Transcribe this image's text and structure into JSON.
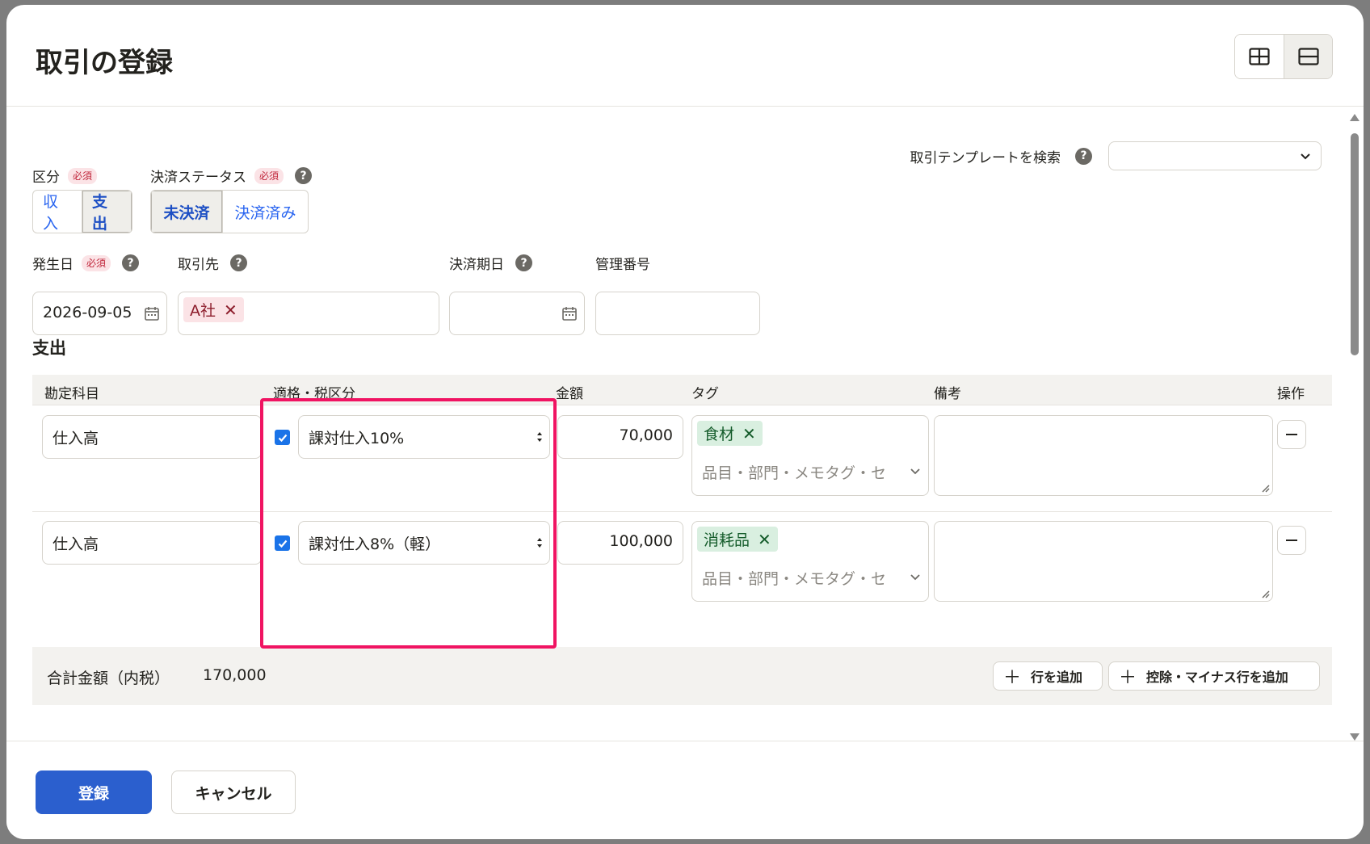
{
  "modal": {
    "title": "取引の登録"
  },
  "template_search": {
    "label": "取引テンプレートを検索",
    "help": "?"
  },
  "category": {
    "label": "区分",
    "required": "必須",
    "options": [
      "収入",
      "支出"
    ],
    "selected": "支出"
  },
  "payment_status": {
    "label": "決済ステータス",
    "required": "必須",
    "help": "?",
    "options": [
      "未決済",
      "決済済み"
    ],
    "selected": "未決済"
  },
  "issue_date": {
    "label": "発生日",
    "required": "必須",
    "help": "?",
    "value": "2026-09-05"
  },
  "partner": {
    "label": "取引先",
    "help": "?",
    "chip": "A社",
    "chip_remove": "✕"
  },
  "due_date": {
    "label": "決済期日",
    "help": "?",
    "value": ""
  },
  "ref_number": {
    "label": "管理番号",
    "value": ""
  },
  "section_title": "支出",
  "table": {
    "headers": {
      "account": "勘定科目",
      "tax": "適格・税区分",
      "amount": "金額",
      "tag": "タグ",
      "note": "備考",
      "ops": "操作"
    },
    "rows": [
      {
        "account": "仕入高",
        "qualified": true,
        "tax_category": "課対仕入10%",
        "amount": "70,000",
        "tag": "食材",
        "tag_remove": "✕",
        "tag_placeholder": "品目・部門・メモタグ・セ",
        "note": ""
      },
      {
        "account": "仕入高",
        "qualified": true,
        "tax_category": "課対仕入8%（軽）",
        "amount": "100,000",
        "tag": "消耗品",
        "tag_remove": "✕",
        "tag_placeholder": "品目・部門・メモタグ・セ",
        "note": ""
      }
    ]
  },
  "totals": {
    "label": "合計金額（内税）",
    "value": "170,000",
    "add_row": "行を追加",
    "add_deduction_row": "控除・マイナス行を追加",
    "plus": "＋"
  },
  "footer": {
    "submit": "登録",
    "cancel": "キャンセル"
  },
  "colors": {
    "primary": "#2b5fce",
    "highlight": "#f01462",
    "required_bg": "#fbe3e6",
    "tag_bg": "#d9efe0"
  }
}
